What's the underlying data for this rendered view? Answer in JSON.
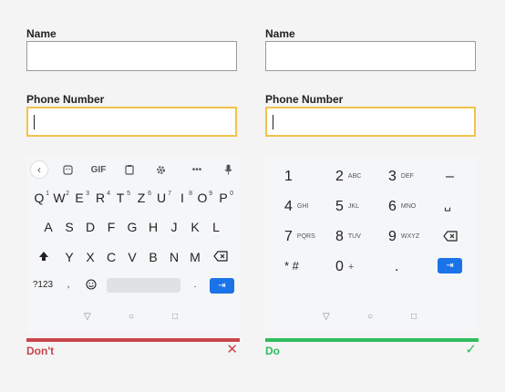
{
  "left": {
    "name_label": "Name",
    "phone_label": "Phone Number",
    "toolbar": {
      "gif": "GIF",
      "more": "•••"
    },
    "rows": [
      [
        "Q",
        "W",
        "E",
        "R",
        "T",
        "Z",
        "U",
        "I",
        "O",
        "P"
      ],
      [
        "A",
        "S",
        "D",
        "F",
        "G",
        "H",
        "J",
        "K",
        "L"
      ],
      [
        "Y",
        "X",
        "C",
        "V",
        "B",
        "N",
        "M"
      ]
    ],
    "row1_digits": [
      "1",
      "2",
      "3",
      "4",
      "5",
      "6",
      "7",
      "8",
      "9",
      "0"
    ],
    "symbols_key": "?123",
    "period_key": ".",
    "comma_key": ",",
    "verdict": "Don't",
    "verdict_icon": "✕"
  },
  "right": {
    "name_label": "Name",
    "phone_label": "Phone Number",
    "numpad": [
      [
        {
          "d": "1",
          "l": ""
        },
        {
          "d": "2",
          "l": "ABC"
        },
        {
          "d": "3",
          "l": "DEF"
        },
        {
          "d": "–",
          "l": ""
        }
      ],
      [
        {
          "d": "4",
          "l": "GHI"
        },
        {
          "d": "5",
          "l": "JKL"
        },
        {
          "d": "6",
          "l": "MNO"
        },
        {
          "d": "␣",
          "l": ""
        }
      ],
      [
        {
          "d": "7",
          "l": "PQRS"
        },
        {
          "d": "8",
          "l": "TUV"
        },
        {
          "d": "9",
          "l": "WXYZ"
        },
        {
          "d": "⌫",
          "l": ""
        }
      ],
      [
        {
          "d": "* #",
          "l": ""
        },
        {
          "d": "0",
          "l": "+"
        },
        {
          "d": ".",
          "l": ""
        },
        {
          "d": "",
          "l": ""
        }
      ]
    ],
    "verdict": "Do",
    "verdict_icon": "✓"
  },
  "colors": {
    "dont": "#c9444a",
    "do": "#2fbd5f",
    "focus": "#f2c24a",
    "enter": "#1a73e8"
  }
}
